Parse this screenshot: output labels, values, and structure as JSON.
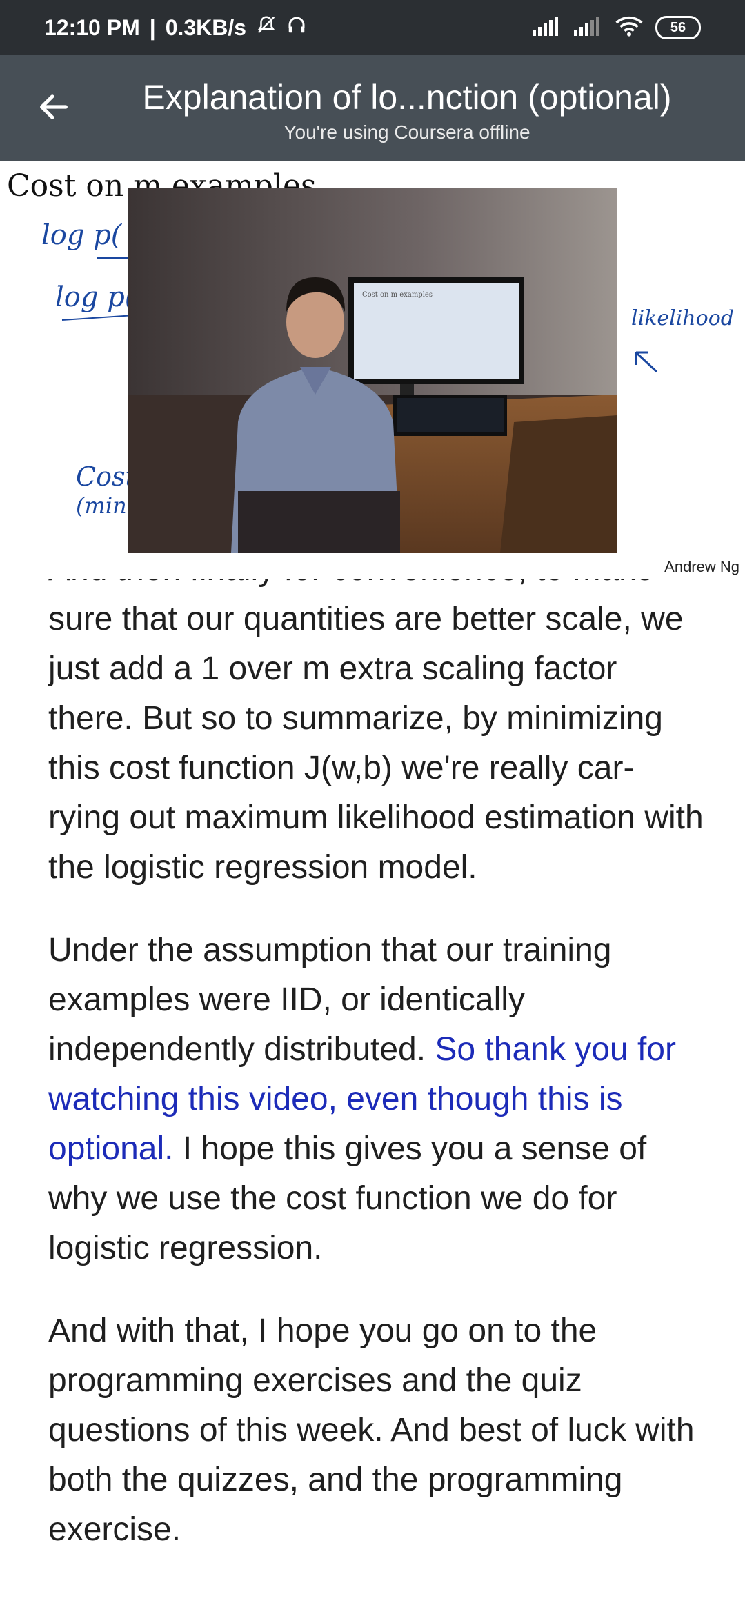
{
  "status_bar": {
    "time": "12:10 PM",
    "network_speed": "0.3KB/s",
    "battery": "56"
  },
  "app_bar": {
    "title": "Explanation of lo...nction (optional)",
    "subtitle": "You're using Coursera offline"
  },
  "slide": {
    "title": "Cost on m examples",
    "annotation_right": "likelihood",
    "attribution": "Andrew Ng"
  },
  "transcript": {
    "cut_line": "And then finally for convenience, to make",
    "para1": "sure that our quantities are better scale, we just add a 1 over m extra scaling factor there. But so to summarize, by minimizing this cost function J(w,b) we're really car-rying out maximum likelihood estimation with the logistic regression model.",
    "para2_start": "Under the assumption that our training examples were IID, or identically independently distributed.",
    "para2_highlight": "So thank you for watching this video, even though this is optional.",
    "para2_end": "I hope this gives you a sense of why we use the cost function we do for logistic regression.",
    "para3": "And with that, I hope you go on to the programming exercises and the quiz questions of this week. And best of luck with both the quizzes, and the programming exercise."
  },
  "colors": {
    "status_bar_bg": "#2b2f33",
    "app_bar_bg": "#474f56",
    "highlight_text": "#1c2bb8"
  }
}
